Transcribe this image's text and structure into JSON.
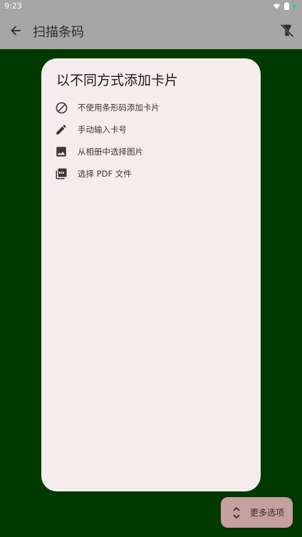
{
  "status_bar": {
    "time": "9:23",
    "icons": [
      "wifi-icon",
      "battery-icon",
      "notification-dot-icon"
    ]
  },
  "app_bar": {
    "title": "扫描条码",
    "back_icon": "back-arrow-icon",
    "flash_icon": "flash-off-icon"
  },
  "card": {
    "title": "以不同方式添加卡片",
    "options": [
      {
        "label": "不使用条形码添加卡片",
        "icon": "no-barcode-icon"
      },
      {
        "label": "手动输入卡号",
        "icon": "pencil-icon"
      },
      {
        "label": "从相册中选择图片",
        "icon": "image-icon"
      },
      {
        "label": "选择 PDF 文件",
        "icon": "pdf-icon"
      }
    ]
  },
  "fab": {
    "label": "更多选项",
    "icon": "expand-icon"
  },
  "colors": {
    "background": "#003A00",
    "app_bar": "#A6A6A6",
    "card": "#F4EDEB",
    "fab": "#C4A09F"
  }
}
